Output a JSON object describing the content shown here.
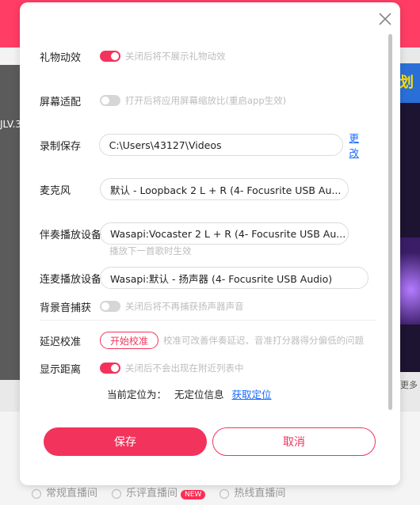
{
  "background": {
    "left_text": "JLV.3",
    "right_top_text": "划",
    "right_more": "更多",
    "radios": [
      {
        "label": "常规直播间"
      },
      {
        "label": "乐评直播间"
      },
      {
        "label": "热线直播间"
      }
    ],
    "new_badge": "NEW"
  },
  "settings": {
    "gift_effect": {
      "label": "礼物动效",
      "hint": "关闭后将不展示礼物动效",
      "on": true
    },
    "screen_fit": {
      "label": "屏幕适配",
      "hint": "打开后将应用屏幕缩放比(重启app生效)",
      "on": false
    },
    "record_save": {
      "label": "录制保存",
      "path": "C:\\Users\\43127\\Videos",
      "change_link": "更改"
    },
    "microphone": {
      "label": "麦克风",
      "value": "默认 - Loopback 2 L + R (4- Focusrite USB Au..."
    },
    "accompany_device": {
      "label": "伴奏播放设备",
      "value": "Wasapi:Vocaster 2 L + R (4- Focusrite USB Au...",
      "sub_hint": "播放下一首歌时生效"
    },
    "mic_link_device": {
      "label": "连麦播放设备",
      "value": "Wasapi:默认 - 扬声器 (4- Focusrite USB Audio)"
    },
    "bg_capture": {
      "label": "背景音捕获",
      "hint": "关闭后将不再捕获扬声器声音",
      "on": false
    },
    "latency": {
      "label": "延迟校准",
      "button": "开始校准",
      "hint": "校准可改善伴奏延迟、音准打分器得分偏低的问题"
    },
    "show_distance": {
      "label": "显示距离",
      "hint": "关闭后不会出现在附近列表中",
      "on": true
    },
    "location": {
      "label": "当前定位为：",
      "value": "无定位信息",
      "link": "获取定位"
    }
  },
  "actions": {
    "save": "保存",
    "cancel": "取消"
  },
  "colors": {
    "accent": "#f2335b",
    "link": "#1769ff"
  }
}
